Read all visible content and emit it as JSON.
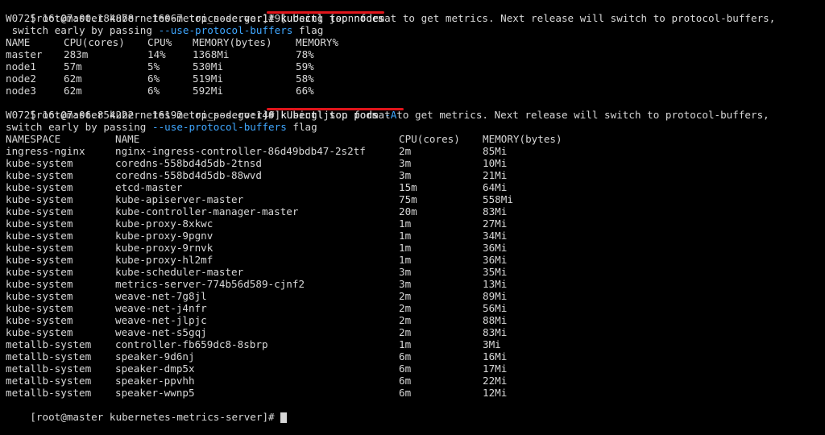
{
  "colors": {
    "background": "#000000",
    "text": "#d7d7d7",
    "flag": "#3fa7ff",
    "highlight_underline": "#e0151b"
  },
  "prompt1": {
    "text": "[root@master kubernetes-metrics-server]# ",
    "command": "kubectl top nodes"
  },
  "warn1": {
    "line1": "W0725 16:07:00.184878   16067 top_node.go:119] Using json format to get metrics. Next release will switch to protocol-buffers,",
    "line2_pre": " switch early by passing ",
    "line2_flag": "--use-protocol-buffers",
    "line2_post": " flag"
  },
  "nodes": {
    "headers": [
      "NAME",
      "CPU(cores)",
      "CPU%",
      "MEMORY(bytes)",
      "MEMORY%"
    ],
    "rows": [
      [
        "master",
        "283m",
        "14%",
        "1368Mi",
        "78%"
      ],
      [
        "node1",
        "57m",
        "5%",
        "530Mi",
        "59%"
      ],
      [
        "node2",
        "62m",
        "6%",
        "519Mi",
        "58%"
      ],
      [
        "node3",
        "62m",
        "6%",
        "592Mi",
        "66%"
      ]
    ]
  },
  "prompt2": {
    "text": "[root@master kubernetes-metrics-server]# ",
    "command_main": "kubectl top pods ",
    "command_flag": "-A"
  },
  "warn2": {
    "line1": "W0725 16:07:06.854222   16192 top_pod.go:140] Using json format to get metrics. Next release will switch to protocol-buffers,",
    "line2_pre": "switch early by passing ",
    "line2_flag": "--use-protocol-buffers",
    "line2_post": " flag"
  },
  "pods": {
    "headers": [
      "NAMESPACE",
      "NAME",
      "CPU(cores)",
      "MEMORY(bytes)"
    ],
    "rows": [
      [
        "ingress-nginx",
        "nginx-ingress-controller-86d49bdb47-2s2tf",
        "2m",
        "85Mi"
      ],
      [
        "kube-system",
        "coredns-558bd4d5db-2tnsd",
        "3m",
        "10Mi"
      ],
      [
        "kube-system",
        "coredns-558bd4d5db-88wvd",
        "3m",
        "21Mi"
      ],
      [
        "kube-system",
        "etcd-master",
        "15m",
        "64Mi"
      ],
      [
        "kube-system",
        "kube-apiserver-master",
        "75m",
        "558Mi"
      ],
      [
        "kube-system",
        "kube-controller-manager-master",
        "20m",
        "83Mi"
      ],
      [
        "kube-system",
        "kube-proxy-8xkwc",
        "1m",
        "27Mi"
      ],
      [
        "kube-system",
        "kube-proxy-9pgnv",
        "1m",
        "34Mi"
      ],
      [
        "kube-system",
        "kube-proxy-9rnvk",
        "1m",
        "36Mi"
      ],
      [
        "kube-system",
        "kube-proxy-hl2mf",
        "1m",
        "36Mi"
      ],
      [
        "kube-system",
        "kube-scheduler-master",
        "3m",
        "35Mi"
      ],
      [
        "kube-system",
        "metrics-server-774b56d589-cjnf2",
        "3m",
        "13Mi"
      ],
      [
        "kube-system",
        "weave-net-7g8jl",
        "2m",
        "89Mi"
      ],
      [
        "kube-system",
        "weave-net-j4nfr",
        "2m",
        "56Mi"
      ],
      [
        "kube-system",
        "weave-net-jlpjc",
        "2m",
        "88Mi"
      ],
      [
        "kube-system",
        "weave-net-s5gqj",
        "2m",
        "83Mi"
      ],
      [
        "metallb-system",
        "controller-fb659dc8-8sbrp",
        "1m",
        "3Mi"
      ],
      [
        "metallb-system",
        "speaker-9d6nj",
        "6m",
        "16Mi"
      ],
      [
        "metallb-system",
        "speaker-dmp5x",
        "6m",
        "17Mi"
      ],
      [
        "metallb-system",
        "speaker-ppvhh",
        "6m",
        "22Mi"
      ],
      [
        "metallb-system",
        "speaker-wwnp5",
        "6m",
        "12Mi"
      ]
    ]
  },
  "prompt3": {
    "text": "[root@master kubernetes-metrics-server]# "
  }
}
